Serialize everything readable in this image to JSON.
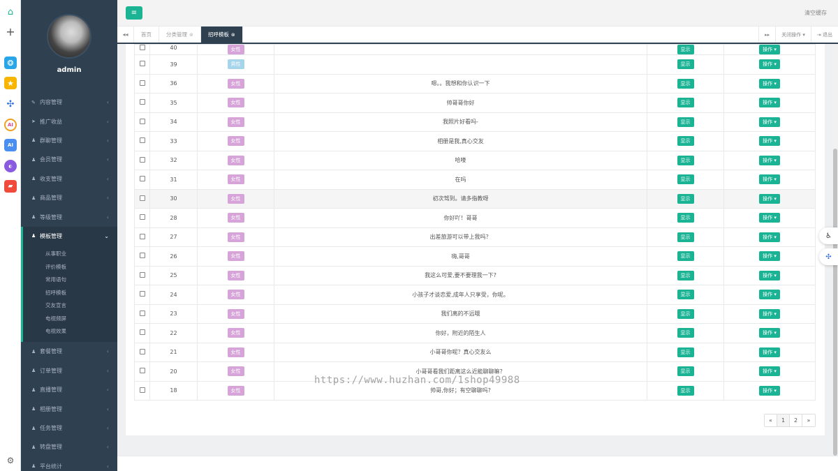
{
  "rail": {
    "home_icon": "⌂",
    "plus_icon": "+",
    "app1": "❂",
    "app2": "★",
    "app3": "✣",
    "app4": "AI",
    "app5": "AI",
    "app6": "◐",
    "app7": "▰",
    "settings_icon": "⚙"
  },
  "sidebar": {
    "admin_name": "admin",
    "menu_before": [
      {
        "icon": "✎",
        "label": "内容管理"
      },
      {
        "icon": "➤",
        "label": "推广收益"
      },
      {
        "icon": "♟",
        "label": "群聊管理"
      },
      {
        "icon": "♟",
        "label": "会员管理"
      },
      {
        "icon": "♟",
        "label": "收支管理"
      },
      {
        "icon": "♟",
        "label": "商品管理"
      },
      {
        "icon": "♟",
        "label": "等级管理"
      }
    ],
    "active_menu": {
      "icon": "♟",
      "label": "模板管理"
    },
    "submenu": [
      "从事职业",
      "评价模板",
      "常用语句",
      "招呼模板",
      "交友宣言",
      "电视频屏",
      "电视效果"
    ],
    "menu_after": [
      {
        "icon": "♟",
        "label": "套餐管理"
      },
      {
        "icon": "♟",
        "label": "订单管理"
      },
      {
        "icon": "♟",
        "label": "直播管理"
      },
      {
        "icon": "♟",
        "label": "相册管理"
      },
      {
        "icon": "♟",
        "label": "任务管理"
      },
      {
        "icon": "♟",
        "label": "转盘管理"
      },
      {
        "icon": "♟",
        "label": "平台统计"
      }
    ],
    "chevron": "‹",
    "chevron_open": "⌄"
  },
  "header": {
    "menu_icon": "≡",
    "clear_cache": "清空缓存"
  },
  "tabs": {
    "prev_icon": "◂◂",
    "next_icon": "▸▸",
    "items": [
      {
        "label": "首页",
        "close": ""
      },
      {
        "label": "分类管理",
        "close": "⊗"
      },
      {
        "label": "招呼模板",
        "close": "⊗"
      }
    ],
    "close_ops": "关闭操作 ▾",
    "logout": "⇥ 退出"
  },
  "table": {
    "rows": [
      {
        "id": "40",
        "cat": "女性",
        "text": "",
        "show": "显示",
        "op": "操作 ▾"
      },
      {
        "id": "39",
        "cat": "男性",
        "text": "",
        "show": "显示",
        "op": "操作 ▾"
      },
      {
        "id": "36",
        "cat": "女性",
        "text": "嗯。。我想和你认识一下",
        "show": "显示",
        "op": "操作 ▾"
      },
      {
        "id": "35",
        "cat": "女性",
        "text": "帅哥哥你好",
        "show": "显示",
        "op": "操作 ▾"
      },
      {
        "id": "34",
        "cat": "女性",
        "text": "我照片好看吗-",
        "show": "显示",
        "op": "操作 ▾"
      },
      {
        "id": "33",
        "cat": "女性",
        "text": "相册是我,真心交友",
        "show": "显示",
        "op": "操作 ▾"
      },
      {
        "id": "32",
        "cat": "女性",
        "text": "哈喽",
        "show": "显示",
        "op": "操作 ▾"
      },
      {
        "id": "31",
        "cat": "女性",
        "text": "在吗",
        "show": "显示",
        "op": "操作 ▾"
      },
      {
        "id": "30",
        "cat": "女性",
        "text": "初次驾到。请多指教呀",
        "show": "显示",
        "op": "操作 ▾"
      },
      {
        "id": "28",
        "cat": "女性",
        "text": "你好吖！哥哥",
        "show": "显示",
        "op": "操作 ▾"
      },
      {
        "id": "27",
        "cat": "女性",
        "text": "出差旅游可以带上我吗？",
        "show": "显示",
        "op": "操作 ▾"
      },
      {
        "id": "26",
        "cat": "女性",
        "text": "嗨,哥哥",
        "show": "显示",
        "op": "操作 ▾"
      },
      {
        "id": "25",
        "cat": "女性",
        "text": "我这么可爱,要不要理我一下?",
        "show": "显示",
        "op": "操作 ▾"
      },
      {
        "id": "24",
        "cat": "女性",
        "text": "小孩子才谈恋爱,成年人只享受，你呢。",
        "show": "显示",
        "op": "操作 ▾"
      },
      {
        "id": "23",
        "cat": "女性",
        "text": "我们离的不远哦",
        "show": "显示",
        "op": "操作 ▾"
      },
      {
        "id": "22",
        "cat": "女性",
        "text": "你好，附近的陌生人",
        "show": "显示",
        "op": "操作 ▾"
      },
      {
        "id": "21",
        "cat": "女性",
        "text": "小哥哥你呢？真心交友么",
        "show": "显示",
        "op": "操作 ▾"
      },
      {
        "id": "20",
        "cat": "女性",
        "text": "小哥哥看我们距离这么近能聊聊嘛？",
        "show": "显示",
        "op": "操作 ▾"
      },
      {
        "id": "18",
        "cat": "女性",
        "text": "帅哥,你好；有空聊聊吗?",
        "show": "显示",
        "op": "操作 ▾"
      }
    ]
  },
  "pagination": {
    "prev": "«",
    "pages": [
      "1",
      "2"
    ],
    "next": "»"
  },
  "floating": {
    "accessibility_icon": "♿",
    "assistant_icon": "✣"
  },
  "watermark": "https://www.huzhan.com/1shop49988"
}
